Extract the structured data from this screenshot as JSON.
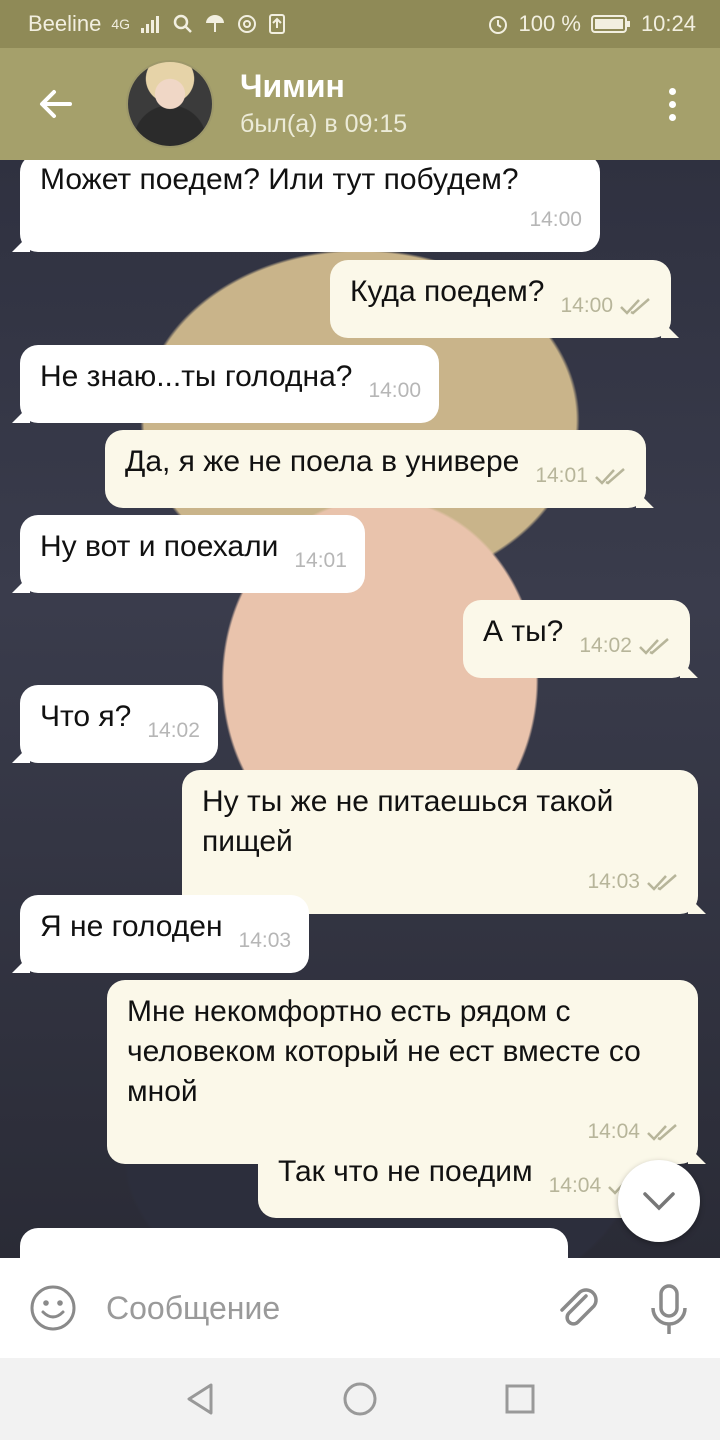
{
  "status_bar": {
    "carrier": "Beeline",
    "network": "4G",
    "battery": "100 %",
    "time": "10:24"
  },
  "header": {
    "contact_name": "Чимин",
    "last_seen": "был(а) в 09:15"
  },
  "messages": [
    {
      "side": "in",
      "text": "Может поедем? Или тут побудем?",
      "time": "14:00"
    },
    {
      "side": "out",
      "text": "Куда поедем?",
      "time": "14:00"
    },
    {
      "side": "in",
      "text": "Не знаю...ты голодна?",
      "time": "14:00"
    },
    {
      "side": "out",
      "text": "Да, я же не поела в универе",
      "time": "14:01"
    },
    {
      "side": "in",
      "text": "Ну вот и поехали",
      "time": "14:01"
    },
    {
      "side": "out",
      "text": "А ты?",
      "time": "14:02"
    },
    {
      "side": "in",
      "text": "Что я?",
      "time": "14:02"
    },
    {
      "side": "out",
      "text": "Ну ты же не питаешься такой пищей",
      "time": "14:03"
    },
    {
      "side": "in",
      "text": "Я не голоден",
      "time": "14:03"
    },
    {
      "side": "out",
      "text": "Мне некомфортно есть рядом с человеком который не ест вместе со мной",
      "time": "14:04"
    },
    {
      "side": "out",
      "text": "Так что не поедим",
      "time": "14:04"
    }
  ],
  "input": {
    "placeholder": "Сообщение"
  },
  "icons": {
    "back": "arrow-left-icon",
    "more": "more-vertical-icon",
    "emoji": "smiley-icon",
    "attach": "paperclip-icon",
    "mic": "microphone-icon",
    "scroll_down": "chevron-down-icon",
    "read": "double-check-icon"
  },
  "colors": {
    "header": "#a5a06b",
    "status_bar": "#8f8a57",
    "incoming_bubble": "#ffffff",
    "outgoing_bubble": "#fbf8e9",
    "read_check": "#b7b59a"
  }
}
